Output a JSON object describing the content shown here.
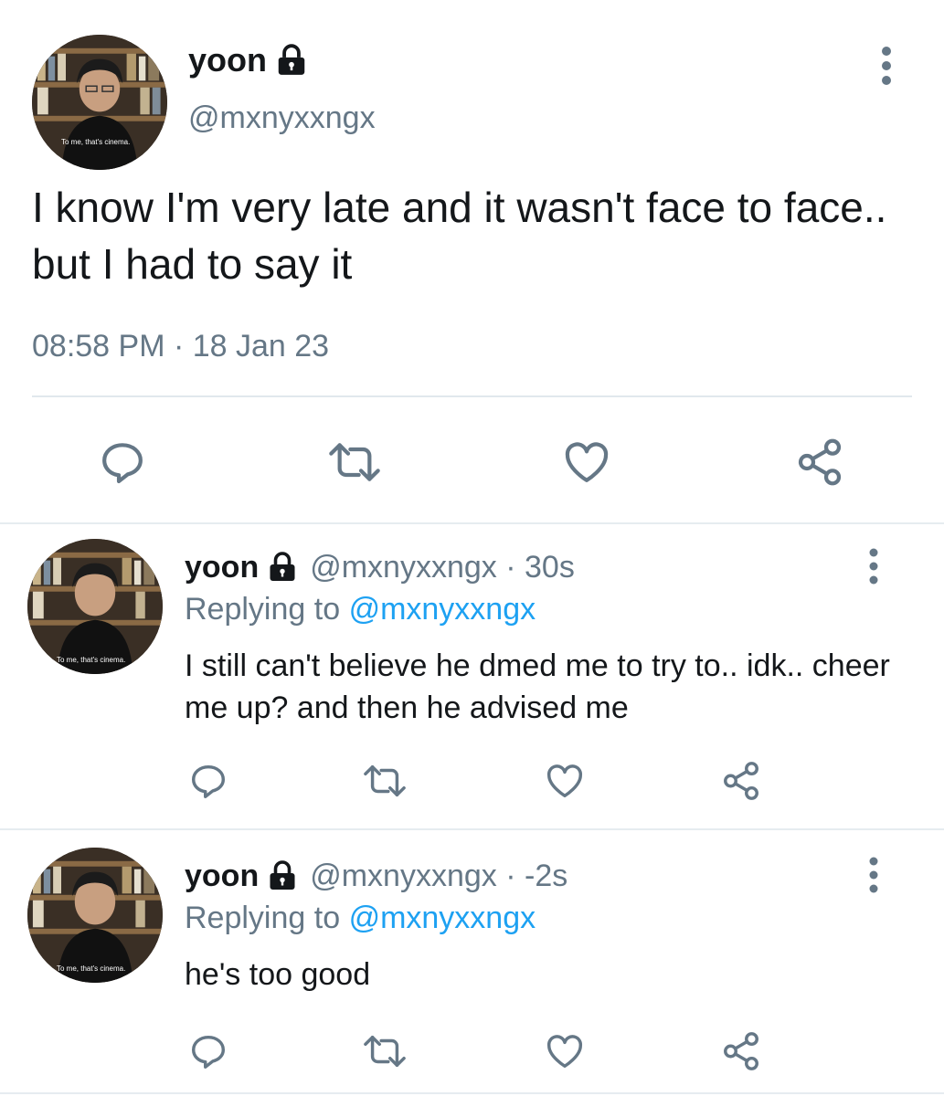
{
  "main_tweet": {
    "display_name": "yoon",
    "handle": "@mxnyxxngx",
    "text": "I know I'm very late and it wasn't face to face.. but I had to say it",
    "timestamp": "08:58 PM · 18 Jan 23",
    "avatar_caption": "To me, that's cinema."
  },
  "replies": [
    {
      "display_name": "yoon",
      "meta": "@mxnyxxngx · 30s",
      "replying_label": "Replying to",
      "replying_handle": "@mxnyxxngx",
      "text": "I still can't believe he dmed me to try to.. idk.. cheer me up? and then he advised me",
      "avatar_caption": "To me, that's cinema."
    },
    {
      "display_name": "yoon",
      "meta": "@mxnyxxngx · -2s",
      "replying_label": "Replying to",
      "replying_handle": "@mxnyxxngx",
      "text": "he's too good",
      "avatar_caption": "To me, that's cinema."
    }
  ],
  "icons": [
    "lock-icon",
    "more-vertical-icon",
    "reply-icon",
    "retweet-icon",
    "like-icon",
    "share-icon"
  ],
  "colors": {
    "text": "#14171a",
    "muted": "#657786",
    "link": "#1da1f2",
    "icon": "#657786"
  }
}
